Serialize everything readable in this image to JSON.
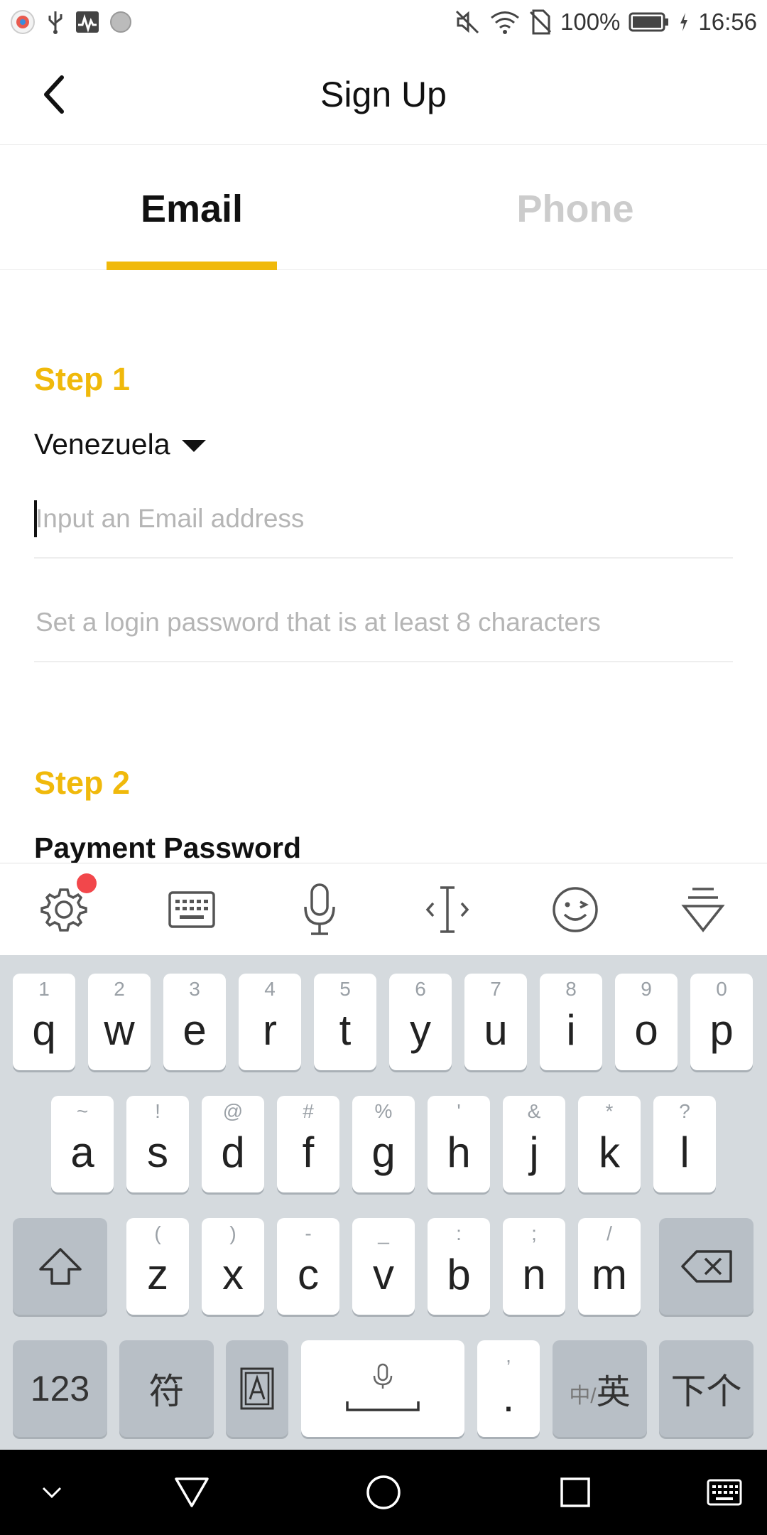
{
  "status_bar": {
    "battery_percent": "100%",
    "time": "16:56"
  },
  "header": {
    "title": "Sign Up"
  },
  "tabs": [
    {
      "label": "Email",
      "active": true
    },
    {
      "label": "Phone",
      "active": false
    }
  ],
  "form": {
    "step1_label": "Step 1",
    "country": "Venezuela",
    "email_placeholder": "Input an Email address",
    "password_placeholder": "Set a login password that is at least 8 characters",
    "step2_label": "Step 2",
    "payment_password_label": "Payment Password"
  },
  "keyboard": {
    "row1": [
      {
        "hint": "1",
        "key": "q"
      },
      {
        "hint": "2",
        "key": "w"
      },
      {
        "hint": "3",
        "key": "e"
      },
      {
        "hint": "4",
        "key": "r"
      },
      {
        "hint": "5",
        "key": "t"
      },
      {
        "hint": "6",
        "key": "y"
      },
      {
        "hint": "7",
        "key": "u"
      },
      {
        "hint": "8",
        "key": "i"
      },
      {
        "hint": "9",
        "key": "o"
      },
      {
        "hint": "0",
        "key": "p"
      }
    ],
    "row2": [
      {
        "hint": "~",
        "key": "a"
      },
      {
        "hint": "!",
        "key": "s"
      },
      {
        "hint": "@",
        "key": "d"
      },
      {
        "hint": "#",
        "key": "f"
      },
      {
        "hint": "%",
        "key": "g"
      },
      {
        "hint": "'",
        "key": "h"
      },
      {
        "hint": "&",
        "key": "j"
      },
      {
        "hint": "*",
        "key": "k"
      },
      {
        "hint": "?",
        "key": "l"
      }
    ],
    "row3": [
      {
        "hint": "(",
        "key": "z"
      },
      {
        "hint": ")",
        "key": "x"
      },
      {
        "hint": "-",
        "key": "c"
      },
      {
        "hint": "_",
        "key": "v"
      },
      {
        "hint": ":",
        "key": "b"
      },
      {
        "hint": ";",
        "key": "n"
      },
      {
        "hint": "/",
        "key": "m"
      }
    ],
    "numbers_key": "123",
    "symbols_key": "符",
    "period_hint": ",",
    "period_key": ".",
    "lang_key_small": "中/",
    "lang_key_big": "英",
    "next_key": "下个"
  },
  "colors": {
    "accent": "#f0b90b",
    "tab_inactive": "#cccccc",
    "placeholder": "#b5b5b5",
    "keyboard_bg": "#d5dade",
    "notification_dot": "#f2474b"
  },
  "icons": {
    "toolbar": [
      "gear-icon",
      "keyboard-icon",
      "microphone-icon",
      "cursor-move-icon",
      "emoji-icon",
      "hide-keyboard-icon"
    ],
    "navbar": [
      "chevron-down-icon",
      "back-triangle-icon",
      "home-circle-icon",
      "recents-square-icon",
      "keyboard-icon"
    ]
  }
}
